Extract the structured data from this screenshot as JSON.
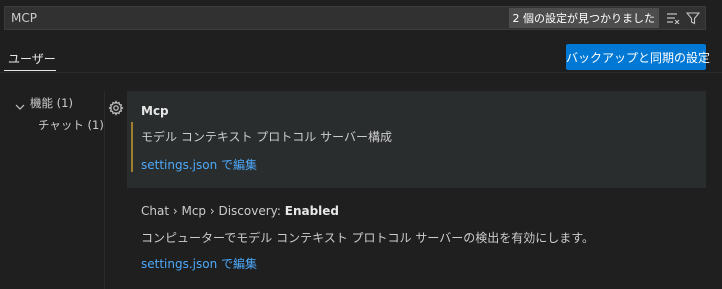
{
  "search": {
    "value": "MCP",
    "result_count": "2 個の設定が見つかりました"
  },
  "tabs": {
    "user": "ユーザー"
  },
  "sync_button": "バックアップと同期の設定",
  "toc": {
    "features": "機能 (1)",
    "chat": "チャット (1)"
  },
  "settings": [
    {
      "title": "Mcp",
      "description": "モデル コンテキスト プロトコル サーバー構成",
      "link": "settings.json で編集"
    },
    {
      "category": "Chat › Mcp › Discovery: ",
      "title": "Enabled",
      "description": "コンピューターでモデル コンテキスト プロトコル サーバーの検出を有効にします。",
      "link": "settings.json で編集"
    }
  ],
  "icons": {
    "clear_filter": "clear-filter-icon",
    "filter": "filter-icon",
    "gear": "gear-icon",
    "chevron": "chevron-down-icon"
  }
}
